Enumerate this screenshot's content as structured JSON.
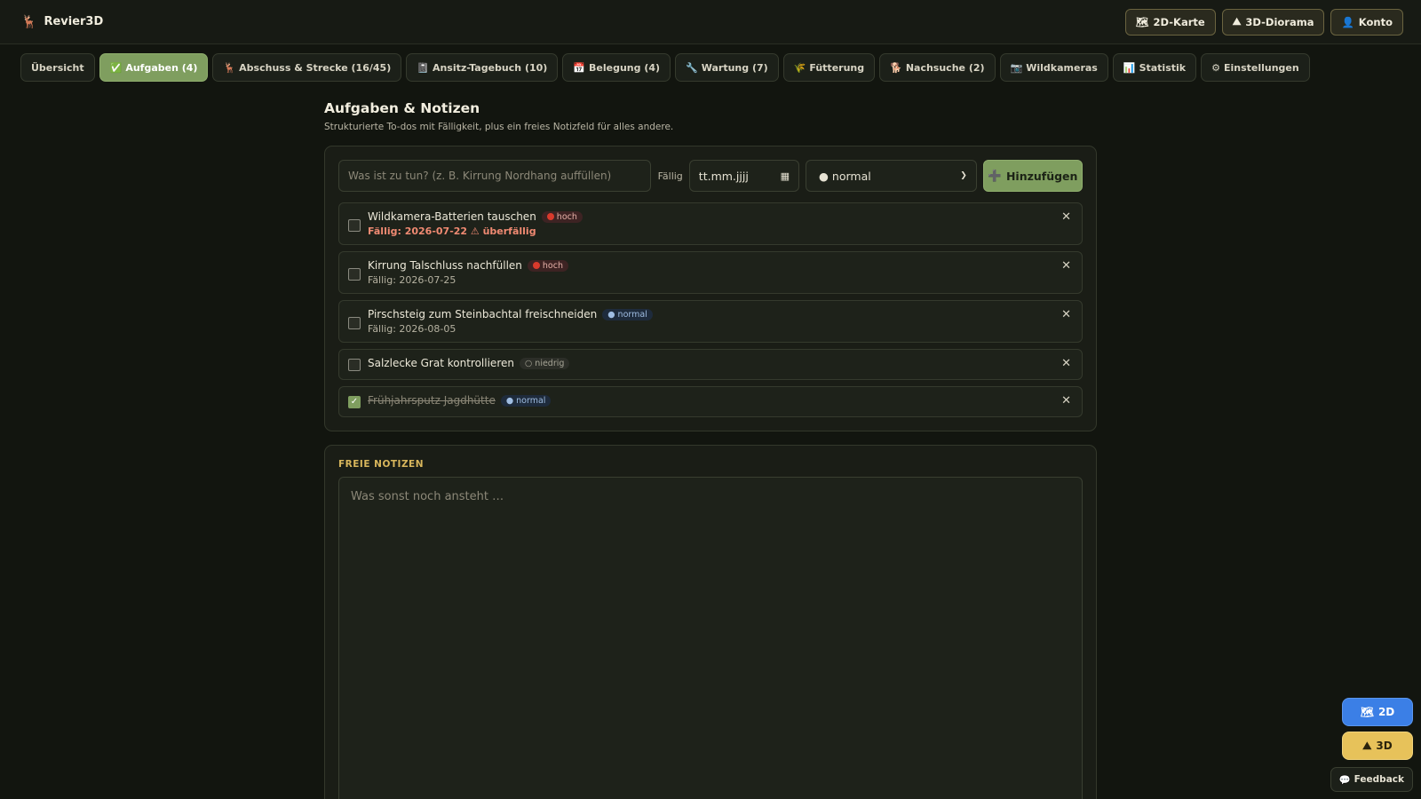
{
  "app": {
    "brand": "Revier3D",
    "brand_icon": "🦌"
  },
  "header_actions": [
    {
      "icon": "🗺",
      "label": "2D-Karte"
    },
    {
      "icon": "⛰",
      "label": "3D-Diorama"
    },
    {
      "icon": "👤",
      "label": "Konto"
    }
  ],
  "tabs": [
    {
      "icon": "",
      "label": "Übersicht"
    },
    {
      "icon": "✅",
      "label": "Aufgaben (4)",
      "active": true
    },
    {
      "icon": "🦌",
      "label": "Abschuss & Strecke (16/45)"
    },
    {
      "icon": "📓",
      "label": "Ansitz-Tagebuch (10)"
    },
    {
      "icon": "📅",
      "label": "Belegung (4)"
    },
    {
      "icon": "🔧",
      "label": "Wartung (7)"
    },
    {
      "icon": "🌾",
      "label": "Fütterung"
    },
    {
      "icon": "🐕",
      "label": "Nachsuche (2)"
    },
    {
      "icon": "📷",
      "label": "Wildkameras"
    },
    {
      "icon": "📊",
      "label": "Statistik"
    },
    {
      "icon": "⚙",
      "label": "Einstellungen"
    }
  ],
  "page": {
    "title": "Aufgaben & Notizen",
    "subtitle": "Strukturierte To-dos mit Fälligkeit, plus ein freies Notizfeld für alles andere."
  },
  "add_form": {
    "task_placeholder": "Was ist zu tun? (z. B. Kirrung Nordhang auffüllen)",
    "due_label": "Fällig",
    "date_placeholder": "tt.mm.jjjj",
    "priority_selected": "● normal",
    "add_button": "Hinzufügen",
    "add_icon": "➕"
  },
  "tasks": [
    {
      "title": "Wildkamera-Batterien tauschen",
      "priority": "hoch",
      "priority_label": "hoch",
      "due": "Fällig: 2026-07-22 ⚠ überfällig",
      "overdue": true,
      "done": false
    },
    {
      "title": "Kirrung Talschluss nachfüllen",
      "priority": "hoch",
      "priority_label": "hoch",
      "due": "Fällig: 2026-07-25",
      "overdue": false,
      "done": false
    },
    {
      "title": "Pirschsteig zum Steinbachtal freischneiden",
      "priority": "normal",
      "priority_label": "● normal",
      "due": "Fällig: 2026-08-05",
      "overdue": false,
      "done": false
    },
    {
      "title": "Salzlecke Grat kontrollieren",
      "priority": "niedrig",
      "priority_label": "○ niedrig",
      "due": "",
      "overdue": false,
      "done": false
    },
    {
      "title": "Frühjahrsputz Jagdhütte",
      "priority": "normal",
      "priority_label": "● normal",
      "due": "",
      "overdue": false,
      "done": true
    }
  ],
  "notes": {
    "heading": "FREIE NOTIZEN",
    "placeholder": "Was sonst noch ansteht …"
  },
  "floating": {
    "btn_2d": "2D",
    "btn_2d_icon": "🗺",
    "btn_3d": "3D",
    "btn_3d_icon": "⛰",
    "feedback": "Feedback",
    "feedback_icon": "💬"
  },
  "colors": {
    "accent": "#7f9e5f",
    "background": "#12150f",
    "overdue": "#f08a72",
    "notes_heading": "#d8b65c"
  }
}
